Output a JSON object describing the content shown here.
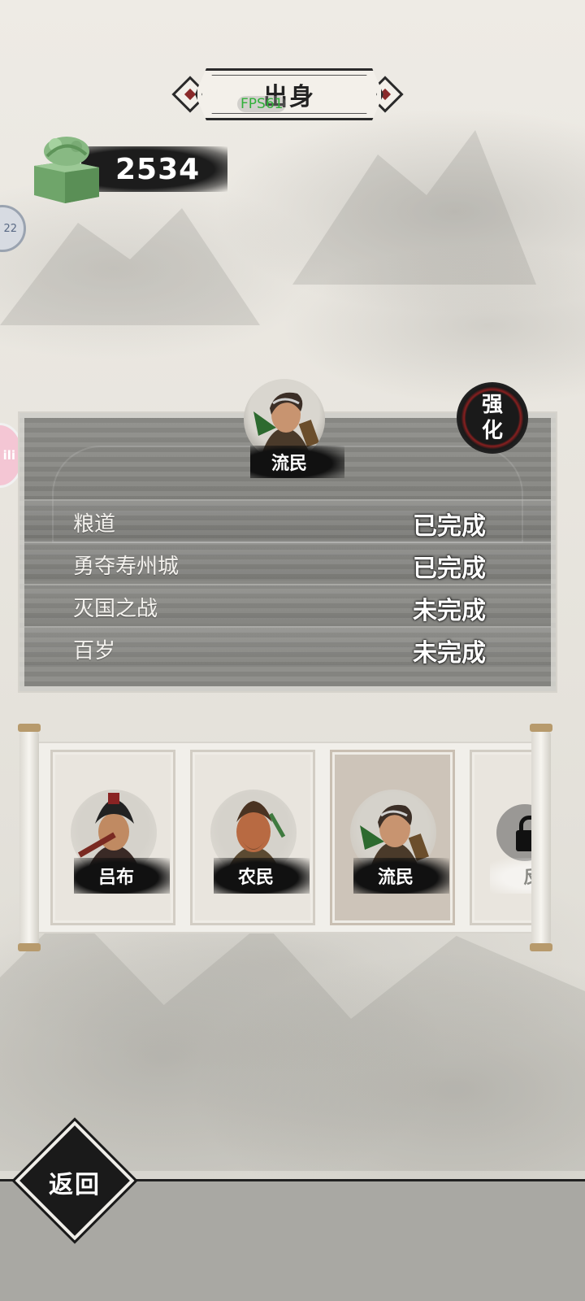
{
  "header": {
    "title": "出身",
    "fps_overlay": "FPS61"
  },
  "currency": {
    "icon": "jade-seal-icon",
    "value": "2534"
  },
  "side_buttons": {
    "top_badge": "22",
    "pink_badge": "ili"
  },
  "selected_origin": {
    "name": "流民",
    "enhance_label_top": "强",
    "enhance_label_bottom": "化"
  },
  "tasks": [
    {
      "name": "粮道",
      "status": "已完成"
    },
    {
      "name": "勇夺寿州城",
      "status": "已完成"
    },
    {
      "name": "灭国之战",
      "status": "未完成"
    },
    {
      "name": "百岁",
      "status": "未完成"
    }
  ],
  "origins": [
    {
      "name": "吕布",
      "locked": false,
      "selected": false
    },
    {
      "name": "农民",
      "locked": false,
      "selected": false
    },
    {
      "name": "流民",
      "locked": false,
      "selected": true
    },
    {
      "name": "反贼",
      "visible_text": "反",
      "locked": true,
      "selected": false
    }
  ],
  "footer": {
    "back_label": "返回"
  },
  "colors": {
    "ink": "#1a1a1a",
    "accent_red": "#8a1f1f",
    "fps_green": "#31b03a",
    "jade": "#7fb07a"
  }
}
